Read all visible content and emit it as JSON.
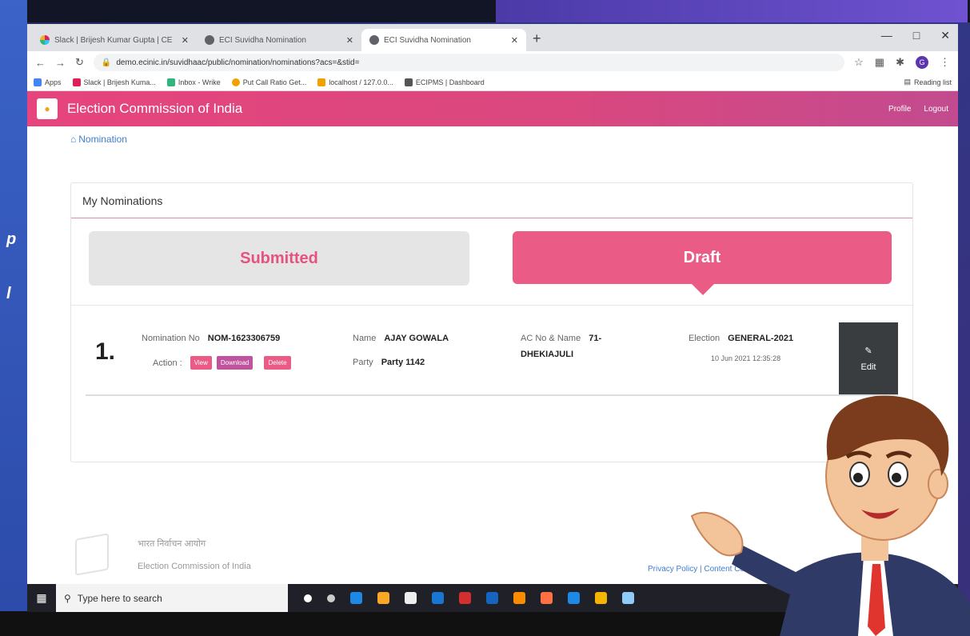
{
  "overlay": {
    "left_glyphs": [
      "p",
      "l"
    ]
  },
  "browser": {
    "tabs": [
      {
        "title": "Slack | Brijesh Kumar Gupta | CE",
        "close": "✕"
      },
      {
        "title": "ECI Suvidha Nomination",
        "close": "✕"
      },
      {
        "title": "ECI Suvidha Nomination",
        "close": "✕"
      }
    ],
    "new_tab": "+",
    "window_controls": [
      "—",
      "□",
      "✕"
    ],
    "url": "demo.ecinic.in/suvidhaac/public/nomination/nominations?acs=&stid=",
    "nav": {
      "back": "←",
      "forward": "→",
      "reload": "↻"
    },
    "profile_initial": "G",
    "bookmarks": [
      {
        "label": "Apps",
        "color": "#4285f4"
      },
      {
        "label": "Slack | Brijesh Kuma...",
        "color": "#e01e5a"
      },
      {
        "label": "Inbox - Wrike",
        "color": "#2eb67d"
      },
      {
        "label": "Put Call Ratio Get...",
        "color": "#f4a100"
      },
      {
        "label": "localhost / 127.0.0...",
        "color": "#f4a100"
      },
      {
        "label": "ECIPMS | Dashboard",
        "color": "#555555"
      }
    ],
    "reading_list": "Reading list"
  },
  "app": {
    "title": "Election Commission of India",
    "links": [
      "Profile",
      "Logout"
    ],
    "breadcrumb": "Nomination"
  },
  "nominations": {
    "card_title": "My Nominations",
    "tabs": {
      "submitted": "Submitted",
      "draft": "Draft"
    },
    "rows": [
      {
        "index": "1.",
        "nomination_label": "Nomination No",
        "nomination_no": "NOM-1623306759",
        "action_label": "Action :",
        "actions": {
          "view": "View",
          "download": "Download",
          "delete": "Delete"
        },
        "name_label": "Name",
        "name": "AJAY GOWALA",
        "party_label": "Party",
        "party": "Party 1142",
        "ac_label": "AC No & Name",
        "ac_value_line1": "71-",
        "ac_value_line2": "DHEKIAJULI",
        "election_label": "Election",
        "election": "GENERAL-2021",
        "timestamp": "10 Jun 2021 12:35:28",
        "edit_label": "Edit"
      }
    ]
  },
  "footer": {
    "hindi": "भारत निर्वाचन आयोग",
    "english": "Election Commission of India",
    "links": "Privacy Policy  |  Content Co"
  },
  "taskbar": {
    "search_placeholder": "Type here to search",
    "icon_colors": [
      "#ffffff",
      "#cccccc",
      "#1e88e5",
      "#f9a825",
      "#eeeeee",
      "#1976d2",
      "#d32f2f",
      "#1565c0",
      "#fb8c00",
      "#ff7043",
      "#1e88e5",
      "#f4b400",
      "#90caf9"
    ]
  }
}
